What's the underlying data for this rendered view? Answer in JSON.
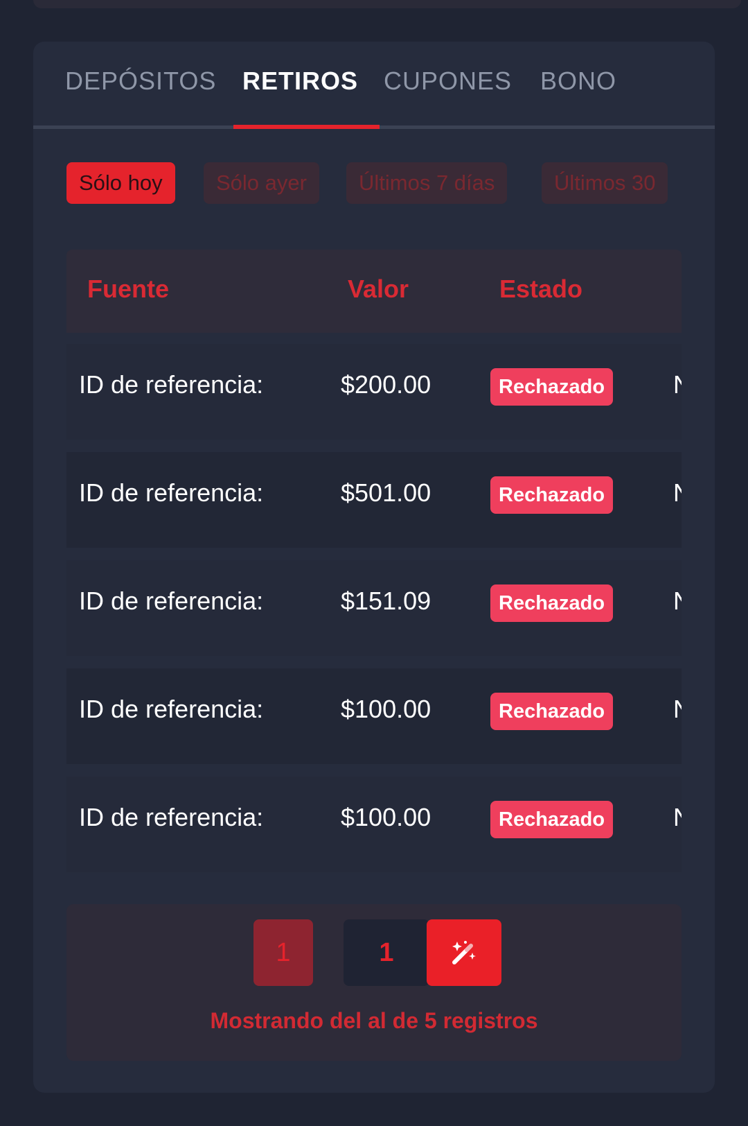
{
  "tabs": [
    {
      "label": "DEPÓSITOS",
      "active": false
    },
    {
      "label": "RETIROS",
      "active": true
    },
    {
      "label": "CUPONES",
      "active": false
    },
    {
      "label": "BONO",
      "active": false
    }
  ],
  "filters": [
    {
      "label": "Sólo hoy",
      "active": true
    },
    {
      "label": "Sólo ayer",
      "active": false
    },
    {
      "label": "Últimos 7 días",
      "active": false
    },
    {
      "label": "Últimos 30",
      "active": false
    }
  ],
  "table": {
    "headers": [
      "Fuente",
      "Valor",
      "Estado"
    ],
    "rows": [
      {
        "source": "ID de referencia:",
        "value": "$200.00",
        "status": "Rechazado",
        "trail": "N"
      },
      {
        "source": "ID de referencia:",
        "value": "$501.00",
        "status": "Rechazado",
        "trail": "N"
      },
      {
        "source": "ID de referencia:",
        "value": "$151.09",
        "status": "Rechazado",
        "trail": "N"
      },
      {
        "source": "ID de referencia:",
        "value": "$100.00",
        "status": "Rechazado",
        "trail": "N"
      },
      {
        "source": "ID de referencia:",
        "value": "$100.00",
        "status": "Rechazado",
        "trail": "N"
      }
    ]
  },
  "pagination": {
    "first_label": "1",
    "current_page": "1",
    "magic_icon": "magic-wand-icon",
    "info": "Mostrando del al de 5 registros"
  },
  "colors": {
    "accent": "#e5232c",
    "status_rejected": "#ef3f5d",
    "background": "#1f2433",
    "card": "#262c3d"
  }
}
